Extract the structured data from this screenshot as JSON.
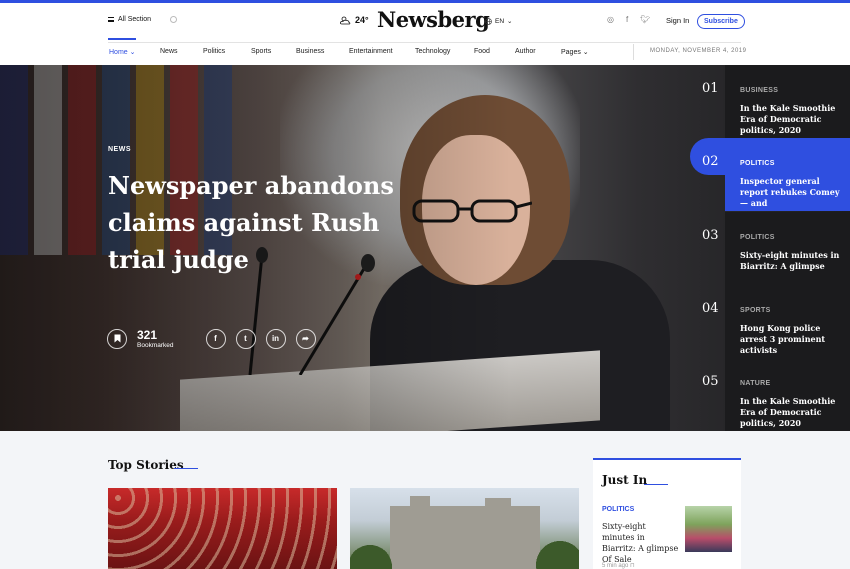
{
  "header": {
    "all_section": "All Section",
    "temperature": "24°",
    "logo": "Newsberg",
    "language": "EN",
    "sign_in": "Sign In",
    "subscribe": "Subscribe"
  },
  "nav": {
    "items": [
      "Home",
      "News",
      "Politics",
      "Sports",
      "Business",
      "Entertainment",
      "Technology",
      "Food",
      "Author",
      "Pages"
    ],
    "date": "MONDAY, NOVEMBER 4, 2019"
  },
  "hero": {
    "category": "NEWS",
    "title": "Newspaper abandons claims against Rush trial judge",
    "bookmark_count": "321",
    "bookmark_label": "Bookmarked"
  },
  "side_list": [
    {
      "num": "01",
      "category": "BUSINESS",
      "title": "In the Kale Smoothie Era of Democratic politics, 2020"
    },
    {
      "num": "02",
      "category": "POLITICS",
      "title": "Inspector general report rebukes Comey — and"
    },
    {
      "num": "03",
      "category": "POLITICS",
      "title": "Sixty-eight minutes in Biarritz: A glimpse"
    },
    {
      "num": "04",
      "category": "SPORTS",
      "title": "Hong Kong police arrest 3 prominent activists"
    },
    {
      "num": "05",
      "category": "NATURE",
      "title": "In the Kale Smoothie Era of Democratic politics, 2020"
    }
  ],
  "top_stories": {
    "heading": "Top Stories"
  },
  "just_in": {
    "heading": "Just In",
    "category": "POLITICS",
    "title": "Sixty-eight minutes in Biarritz: A glimpse Of Sale",
    "time": "5 min ago"
  },
  "colors": {
    "accent": "#2f4fe0",
    "dark_panel": "#1b1b1d"
  }
}
